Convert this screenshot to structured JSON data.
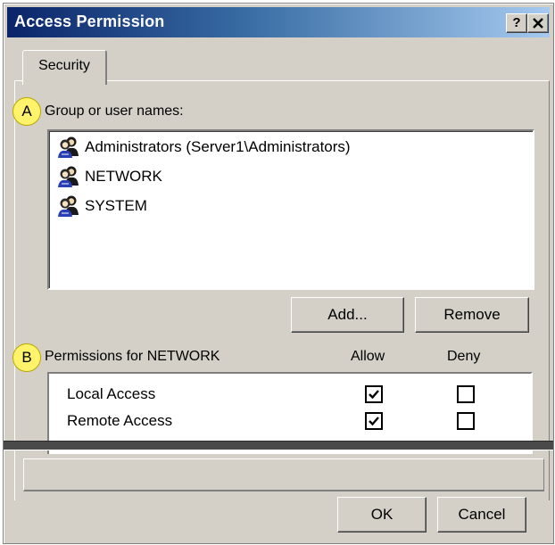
{
  "window": {
    "title": "Access Permission",
    "help_button": "?",
    "close_button": "X"
  },
  "tabs": [
    {
      "label": "Security",
      "selected": true
    }
  ],
  "callouts": {
    "a": "A",
    "b": "B"
  },
  "group_section": {
    "label": "Group or user names:",
    "users": [
      {
        "name": "Administrators (Server1\\Administrators)",
        "icon": "users-group-icon"
      },
      {
        "name": "NETWORK",
        "icon": "users-group-icon"
      },
      {
        "name": "SYSTEM",
        "icon": "users-group-icon"
      }
    ]
  },
  "buttons": {
    "add": "Add...",
    "remove": "Remove",
    "ok": "OK",
    "cancel": "Cancel"
  },
  "permissions": {
    "label": "Permissions for NETWORK",
    "allow_header": "Allow",
    "deny_header": "Deny",
    "rows": [
      {
        "name": "Local Access",
        "allow": true,
        "deny": false
      },
      {
        "name": "Remote Access",
        "allow": true,
        "deny": false
      }
    ]
  },
  "colors": {
    "dialog_face": "#d4d0c8",
    "title_gradient_start": "#0a246a",
    "title_gradient_end": "#a6caf0",
    "callout_fill": "#fff36b"
  }
}
